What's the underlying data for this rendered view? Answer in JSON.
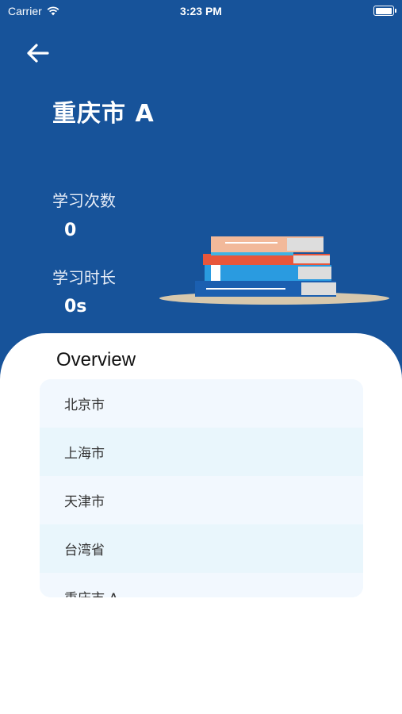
{
  "status_bar": {
    "carrier": "Carrier",
    "time": "3:23 PM",
    "battery_level": 1.0
  },
  "header": {
    "back_icon": "arrow-left-icon",
    "title": "重庆市 A"
  },
  "stats": {
    "study_count_label": "学习次数",
    "study_count_value": "0",
    "study_duration_label": "学习时长",
    "study_duration_value": "0s"
  },
  "overview": {
    "title": "Overview",
    "items": [
      {
        "label": "北京市"
      },
      {
        "label": "上海市"
      },
      {
        "label": "天津市"
      },
      {
        "label": "台湾省"
      },
      {
        "label": "重庆市 A"
      }
    ]
  },
  "colors": {
    "background": "#17539a",
    "sheet": "#ffffff",
    "row_odd": "#f2f8fe",
    "row_even": "#e9f6fc"
  }
}
